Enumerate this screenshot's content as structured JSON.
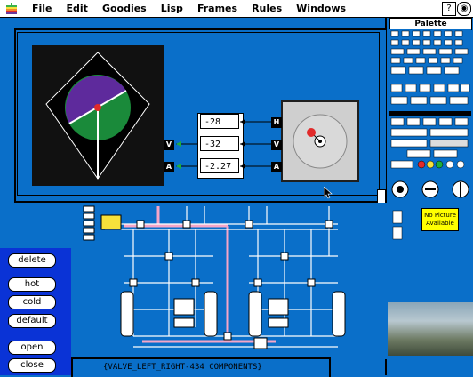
{
  "menubar": {
    "items": [
      "File",
      "Edit",
      "Goodies",
      "Lisp",
      "Frames",
      "Rules",
      "Windows"
    ],
    "help_glyph": "?"
  },
  "view": {
    "port_h": "H",
    "port_v": "V",
    "port_a": "A",
    "values": [
      "-28",
      "-32",
      "-2.27"
    ]
  },
  "palette": {
    "title": "Palette",
    "no_picture": "No Picture Available"
  },
  "buttons": {
    "delete": "delete",
    "hot": "hot",
    "cold": "cold",
    "default": "default",
    "open": "open",
    "close": "close"
  },
  "status": {
    "text": "{VALVE_LEFT_RIGHT-434 COMPONENTS}"
  },
  "icons": {
    "apple": "apple-icon",
    "help": "help-icon",
    "app": "app-icon"
  }
}
